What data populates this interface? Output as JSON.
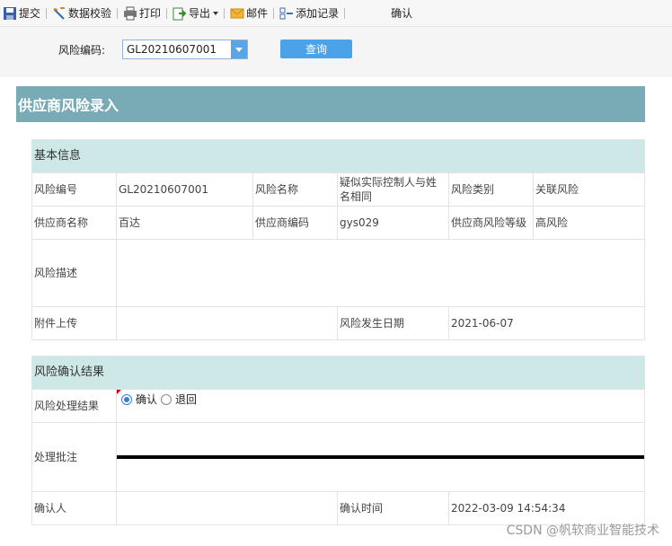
{
  "toolbar": {
    "submit": "提交",
    "validate": "数据校验",
    "print": "打印",
    "export": "导出",
    "email": "邮件",
    "add_record": "添加记录",
    "confirm": "确认"
  },
  "query": {
    "label": "风险编码:",
    "value": "GL20210607001",
    "button": "查询"
  },
  "form_title": "供应商风险录入",
  "basic": {
    "header": "基本信息",
    "risk_code_label": "风险编号",
    "risk_code_value": "GL20210607001",
    "risk_name_label": "风险名称",
    "risk_name_value": "疑似实际控制人与姓名相同",
    "risk_type_label": "风险类别",
    "risk_type_value": "关联风险",
    "supplier_name_label": "供应商名称",
    "supplier_name_value": "百达",
    "supplier_code_label": "供应商编码",
    "supplier_code_value": "gys029",
    "risk_level_label": "供应商风险等级",
    "risk_level_value": "高风险",
    "desc_label": "风险描述",
    "attach_label": "附件上传",
    "date_label": "风险发生日期",
    "date_value": "2021-06-07"
  },
  "confirm_section": {
    "header": "风险确认结果",
    "result_label": "风险处理结果",
    "opt_confirm": "确认",
    "opt_return": "退回",
    "note_label": "处理批注",
    "person_label": "确认人",
    "time_label": "确认时间",
    "time_value": "2022-03-09 14:54:34"
  },
  "watermark": "CSDN @帆软商业智能技术",
  "icons": [
    "save-icon",
    "validate-icon",
    "print-icon",
    "export-icon",
    "chevron-down-icon",
    "email-icon",
    "add-record-icon",
    "dropdown-arrow-icon"
  ]
}
